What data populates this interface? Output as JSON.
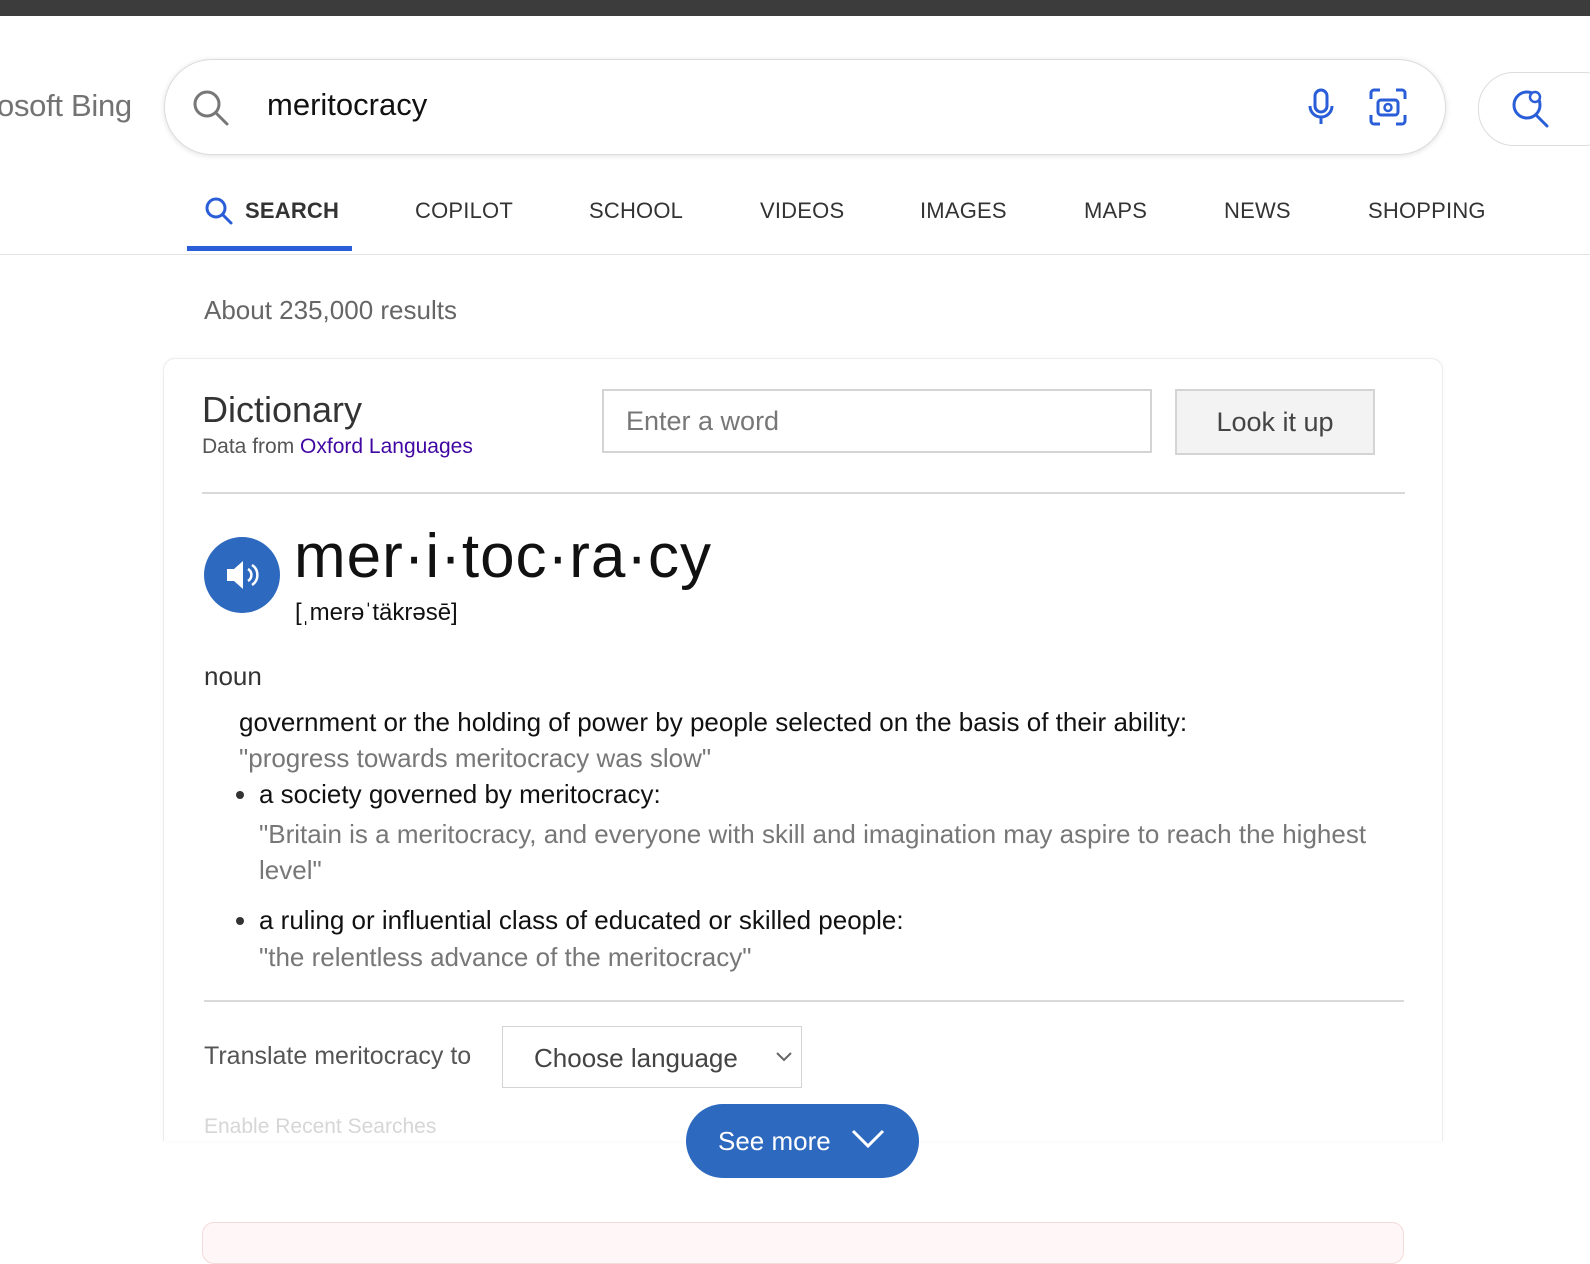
{
  "header": {
    "logo_text": "osoft Bing",
    "search_query": "meritocracy"
  },
  "tabs": [
    {
      "label": "SEARCH",
      "active": true
    },
    {
      "label": "COPILOT"
    },
    {
      "label": "SCHOOL"
    },
    {
      "label": "VIDEOS"
    },
    {
      "label": "IMAGES"
    },
    {
      "label": "MAPS"
    },
    {
      "label": "NEWS"
    },
    {
      "label": "SHOPPING"
    }
  ],
  "results_count": "About 235,000 results",
  "dictionary": {
    "title": "Dictionary",
    "source_prefix": "Data from",
    "source_link": "Oxford Languages",
    "input_placeholder": "Enter a word",
    "lookup_button": "Look it up",
    "headword": "mer·i·toc·ra·cy",
    "pronunciation": "[ˌmerəˈtäkrəsē]",
    "part_of_speech": "noun",
    "definition": "government or the holding of power by people selected on the basis of their ability:",
    "example": "\"progress towards meritocracy was slow\"",
    "sub_senses": [
      {
        "definition": "a society governed by meritocracy:",
        "example": "\"Britain is a meritocracy, and everyone with skill and imagination may aspire to reach the highest level\""
      },
      {
        "definition": "a ruling or influential class of educated or skilled people:",
        "example": "\"the relentless advance of the meritocracy\""
      }
    ],
    "translate_label": "Translate meritocracy to",
    "language_select": "Choose language",
    "faded_text": "Enable Recent Searches",
    "see_more": "See more"
  },
  "colors": {
    "accent": "#2a5dd8",
    "button_blue": "#2d6abf",
    "link_purple": "#4007a2"
  }
}
